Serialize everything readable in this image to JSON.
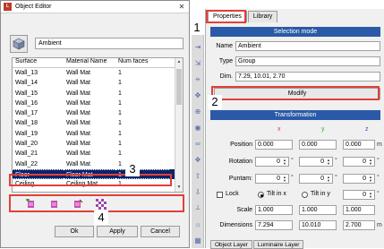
{
  "editor": {
    "title": "Object Editor",
    "object_name": "Ambient",
    "columns": [
      "Surface",
      "Material Name",
      "Num faces"
    ],
    "rows": [
      [
        "Wall_13",
        "Wall Mat",
        "1"
      ],
      [
        "Wall_14",
        "Wall Mat",
        "1"
      ],
      [
        "Wall_15",
        "Wall Mat",
        "1"
      ],
      [
        "Wall_16",
        "Wall Mat",
        "1"
      ],
      [
        "Wall_17",
        "Wall Mat",
        "1"
      ],
      [
        "Wall_18",
        "Wall Mat",
        "1"
      ],
      [
        "Wall_19",
        "Wall Mat",
        "1"
      ],
      [
        "Wall_20",
        "Wall Mat",
        "1"
      ],
      [
        "Wall_21",
        "Wall Mat",
        "1"
      ],
      [
        "Wall_22",
        "Wall Mat",
        "1"
      ],
      [
        "Floor",
        "Floor Mat",
        "1"
      ],
      [
        "Ceiling",
        "Ceiling Mat",
        "1"
      ]
    ],
    "selected_row_index": 10,
    "toolbar_icons": [
      "add-material-icon",
      "material-icon",
      "material-edit-icon",
      "checker-texture-icon"
    ],
    "buttons": {
      "ok": "Ok",
      "apply": "Apply",
      "cancel": "Cancel"
    }
  },
  "panel": {
    "tabs": [
      "Properties",
      "Library"
    ],
    "active_tab": "Properties",
    "selection_header": "Selection mode",
    "name_label": "Name",
    "name_value": "Ambient",
    "type_label": "Type",
    "type_value": "Group",
    "dim_label": "Dim.",
    "dim_value": "7.29, 10.01, 2.70",
    "modify_label": "Modify",
    "transformation_header": "Transformation",
    "axes": [
      "x",
      "y",
      "z"
    ],
    "position_label": "Position",
    "position": [
      "0.000",
      "0.000",
      "0.000"
    ],
    "position_unit": "m",
    "rotation_label": "Rotation",
    "rotation": [
      "0",
      "0",
      "0"
    ],
    "rotation_unit": "°",
    "puntam_label": "Puntam:",
    "puntam": [
      "0",
      "0",
      "0"
    ],
    "puntam_unit": "°",
    "lock_label": "Lock",
    "tilt_x_label": "Tilt in x",
    "tilt_y_label": "Tilt in y",
    "tilt_value": "0",
    "tilt_unit": "°",
    "scale_label": "Scale",
    "scale": [
      "1.000",
      "1.000",
      "1.000"
    ],
    "dimensions_label": "Dimensions",
    "dimensions": [
      "7.294",
      "10.010",
      "2.700"
    ],
    "dimensions_unit": "m",
    "bottom_tabs": [
      "Object Layer",
      "Luminaire Layer"
    ]
  },
  "callouts": [
    "1",
    "2",
    "3",
    "4"
  ],
  "colors": {
    "highlight": "#e0403a",
    "header_blue": "#2a5aa7",
    "selection": "#0a246a",
    "axis_x": "#d0463c",
    "axis_y": "#3f9a3a",
    "axis_z": "#3555b5"
  }
}
